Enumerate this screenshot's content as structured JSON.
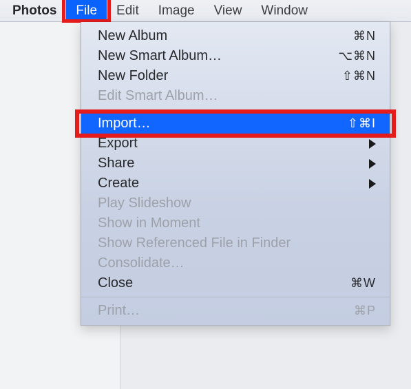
{
  "menubar": {
    "appname": "Photos",
    "items": [
      {
        "label": "File",
        "active": true
      },
      {
        "label": "Edit"
      },
      {
        "label": "Image"
      },
      {
        "label": "View"
      },
      {
        "label": "Window"
      }
    ]
  },
  "dropdown": {
    "groups": [
      [
        {
          "label": "New Album",
          "shortcut": "⌘N"
        },
        {
          "label": "New Smart Album…",
          "shortcut": "⌥⌘N"
        },
        {
          "label": "New Folder",
          "shortcut": "⇧⌘N"
        },
        {
          "label": "Edit Smart Album…",
          "disabled": true
        }
      ],
      [
        {
          "label": "Import…",
          "shortcut": "⇧⌘I",
          "selected": true,
          "highlighted": true
        },
        {
          "label": "Export",
          "submenu": true
        },
        {
          "label": "Share",
          "submenu": true
        },
        {
          "label": "Create",
          "submenu": true
        },
        {
          "label": "Play Slideshow",
          "disabled": true
        },
        {
          "label": "Show in Moment",
          "disabled": true
        },
        {
          "label": "Show Referenced File in Finder",
          "disabled": true
        },
        {
          "label": "Consolidate…",
          "disabled": true
        },
        {
          "label": "Close",
          "shortcut": "⌘W"
        }
      ],
      [
        {
          "label": "Print…",
          "shortcut": "⌘P",
          "disabled": true
        }
      ]
    ]
  }
}
